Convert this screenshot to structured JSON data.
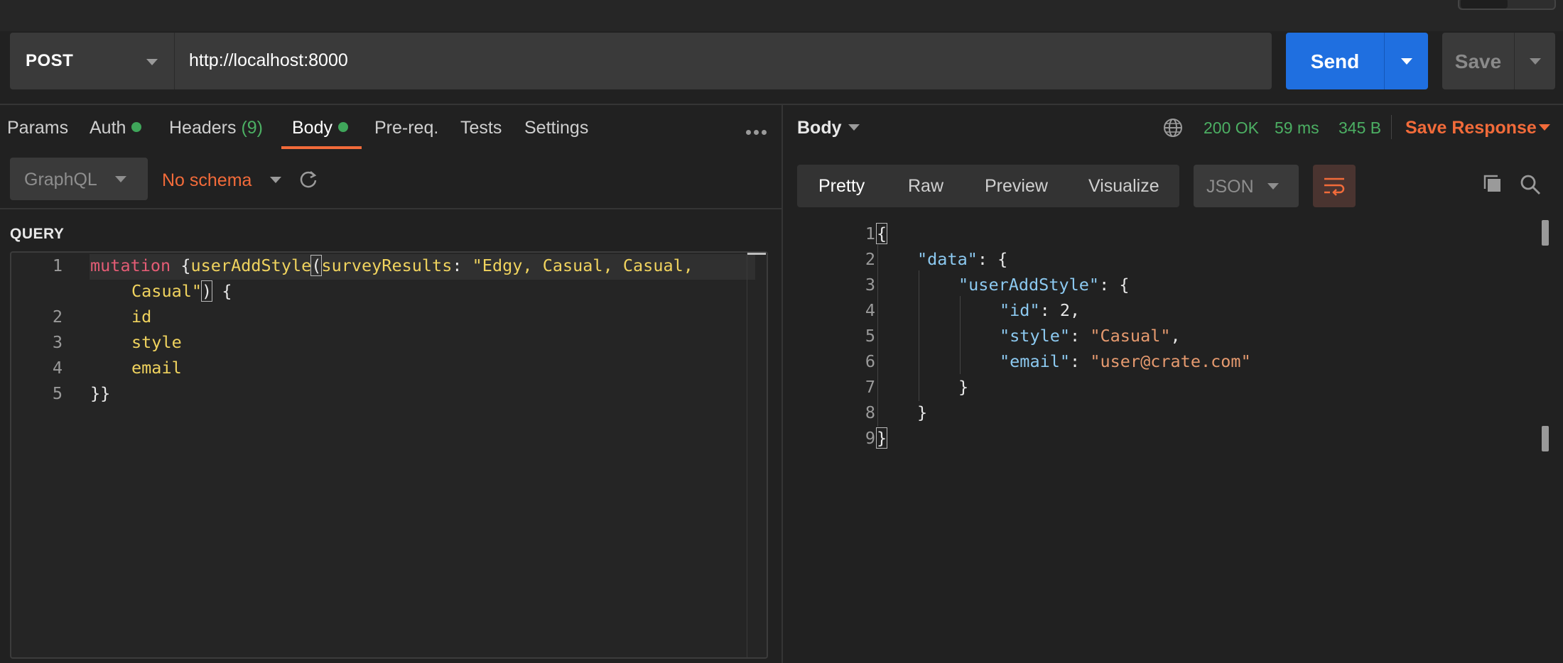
{
  "request": {
    "method": "POST",
    "url": "http://localhost:8000",
    "send_label": "Send",
    "save_label": "Save"
  },
  "request_tabs": [
    {
      "label": "Params"
    },
    {
      "label": "Auth"
    },
    {
      "label": "Headers",
      "count": "(9)"
    },
    {
      "label": "Body"
    },
    {
      "label": "Pre-req."
    },
    {
      "label": "Tests"
    },
    {
      "label": "Settings"
    }
  ],
  "body_mode": "GraphQL",
  "schema_label": "No schema",
  "query_label": "QUERY",
  "query_lines": {
    "l1": "1",
    "l2": "2",
    "l3": "3",
    "l4": "4",
    "l5": "5",
    "mutation": "mutation",
    "fn": "userAddStyle",
    "arg": "surveyResults",
    "arg_value_1": "\"Edgy, Casual, Casual,",
    "arg_value_2": "Casual\"",
    "f1": "id",
    "f2": "style",
    "f3": "email",
    "close": "}}"
  },
  "response": {
    "body_label": "Body",
    "status": "200 OK",
    "time": "59 ms",
    "size": "345 B",
    "save_response_label": "Save Response",
    "view_tabs": [
      "Pretty",
      "Raw",
      "Preview",
      "Visualize"
    ],
    "format": "JSON",
    "json": {
      "k_data": "\"data\"",
      "k_root": "\"userAddStyle\"",
      "k_id": "\"id\"",
      "v_id": "2",
      "k_style": "\"style\"",
      "v_style": "\"Casual\"",
      "k_email": "\"email\"",
      "v_email": "\"user@crate.com\""
    }
  },
  "colors": {
    "accent": "#f26b3a",
    "send": "#1f6fe0",
    "success": "#4caf63"
  }
}
